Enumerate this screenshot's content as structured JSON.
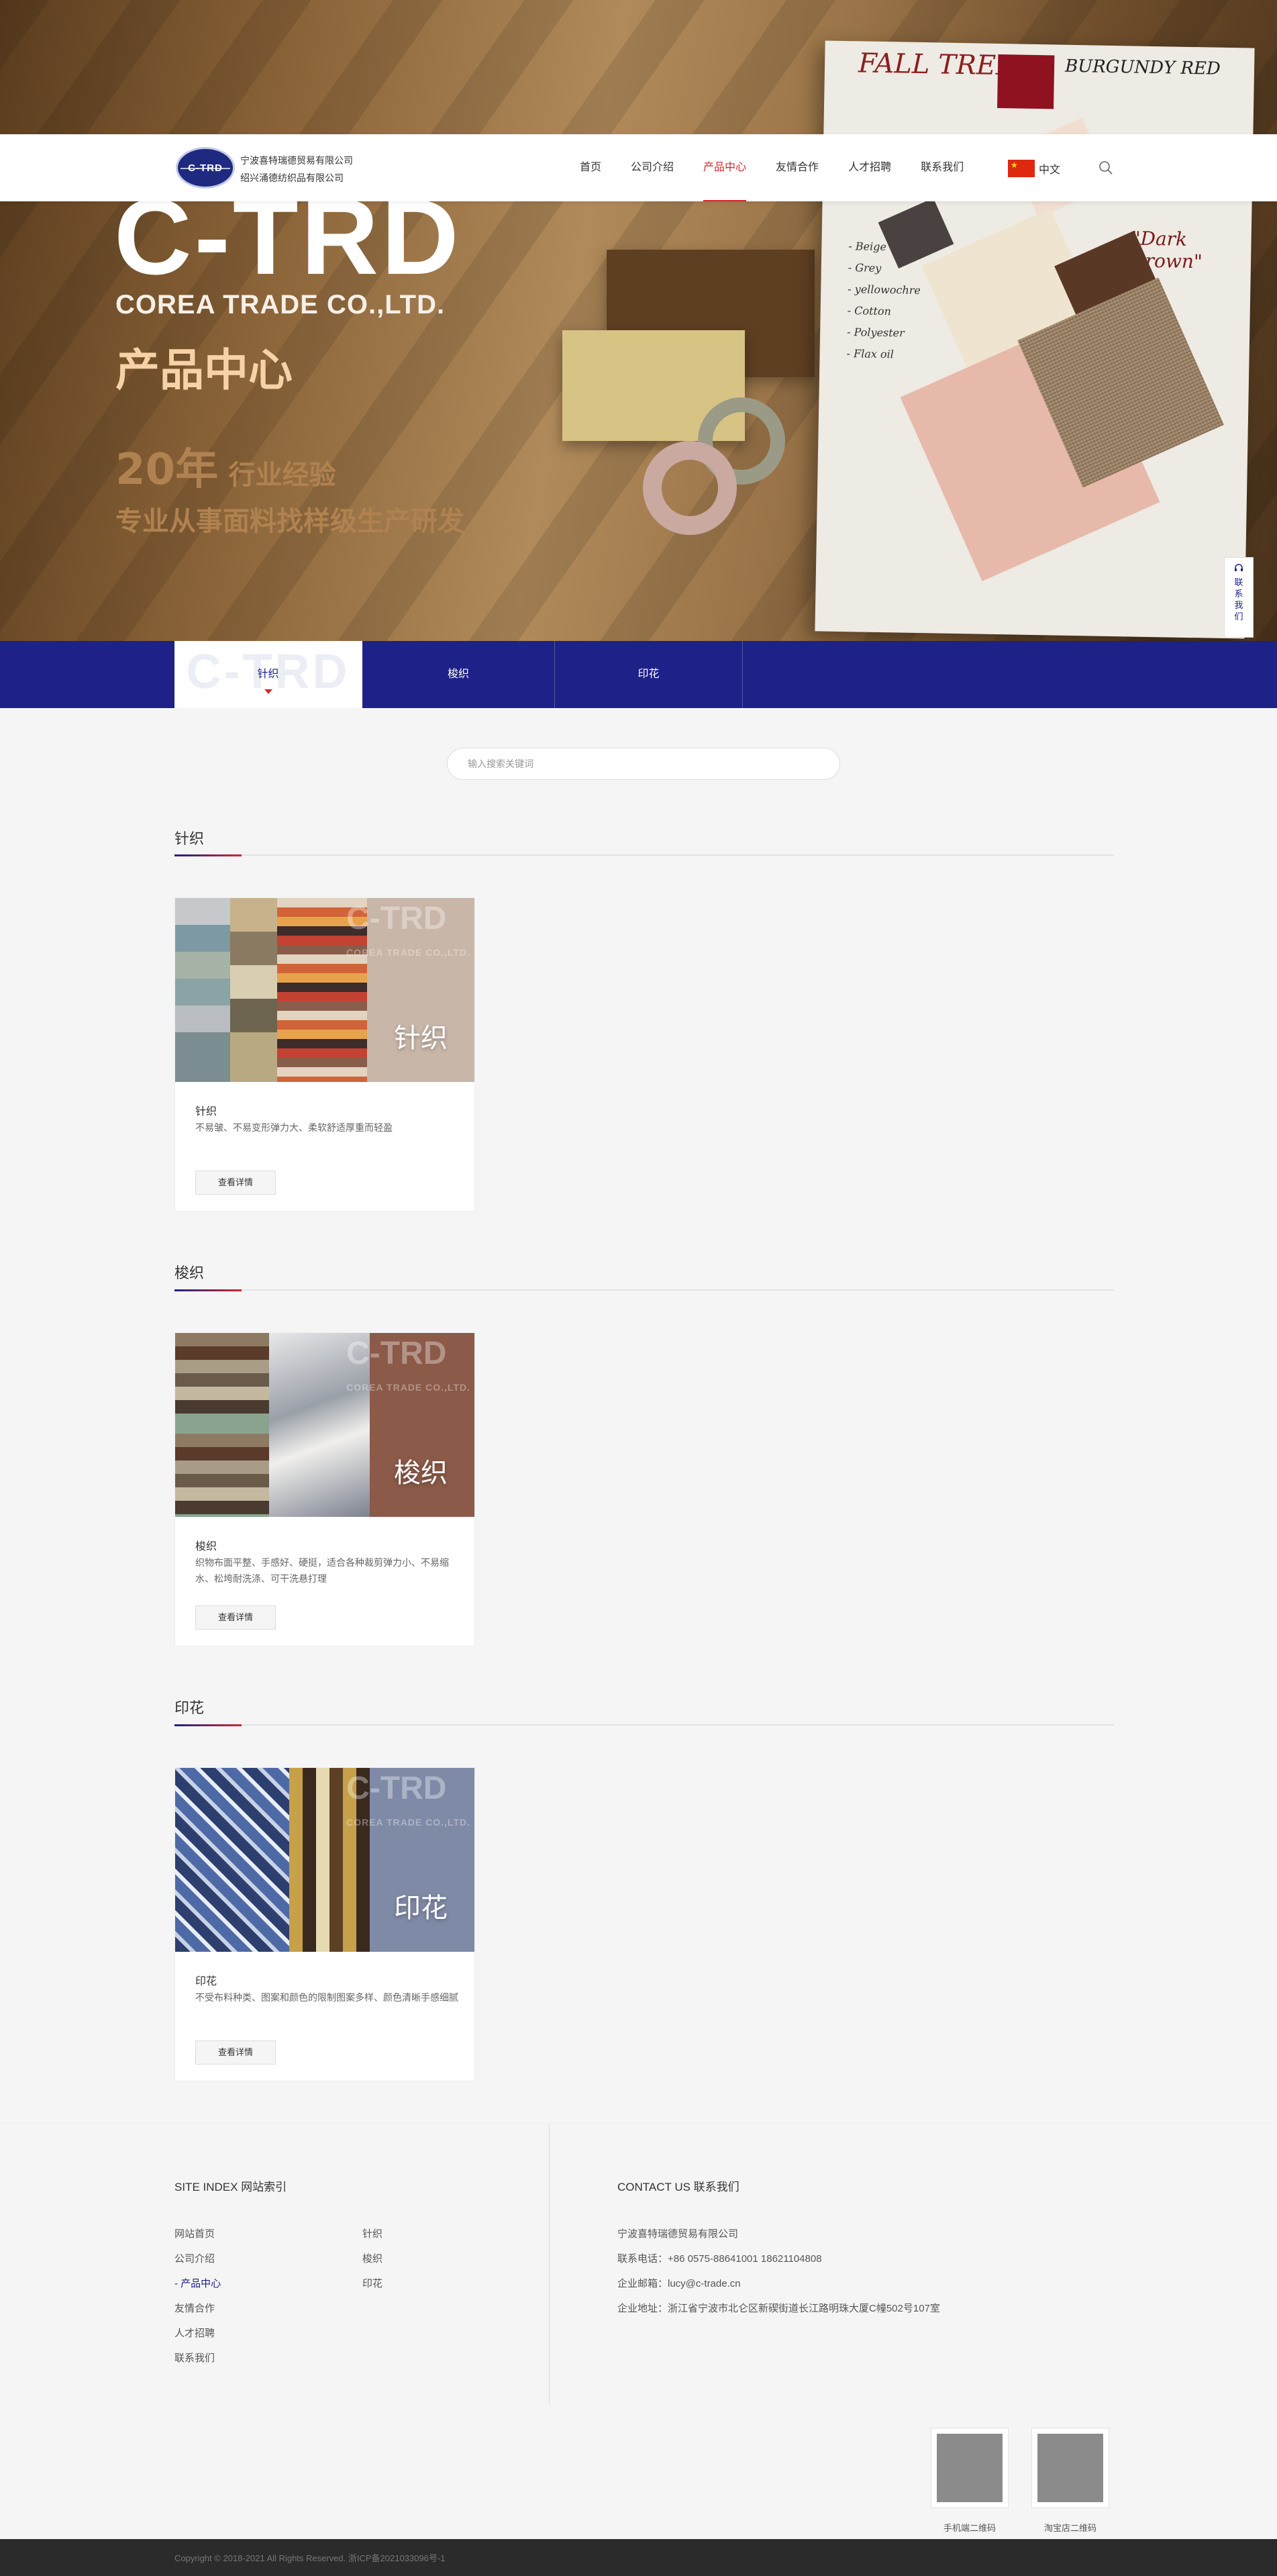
{
  "banner": {
    "brand": "C-TRD",
    "brand_sub": "COREA TRADE CO.,LTD.",
    "page_title": "产品中心",
    "years_num": "20年",
    "years_text": "行业经验",
    "slogan": "专业从事面料找样级生产研发",
    "board_title": "FALL TREND",
    "board_red": "BURGUNDY RED",
    "board_brown": "\"Dark Brown\"",
    "board_notes": [
      "- Beige",
      "- Grey",
      "- yellowochre",
      "- Cotton",
      "- Polyester",
      "- Flax oil"
    ]
  },
  "header": {
    "logo_text": "C-TRD",
    "company_line1": "宁波喜特瑞德贸易有限公司",
    "company_line2": "绍兴涌德纺织品有限公司",
    "nav": [
      "首页",
      "公司介绍",
      "产品中心",
      "友情合作",
      "人才招聘",
      "联系我们"
    ],
    "lang": "中文"
  },
  "side": {
    "contact": [
      "联",
      "系",
      "我",
      "们"
    ]
  },
  "categories": {
    "watermark": "C-TRD",
    "tabs": [
      "针织",
      "梭织",
      "印花"
    ]
  },
  "search": {
    "placeholder": "输入搜索关键词"
  },
  "sections": [
    {
      "title": "针织",
      "product": {
        "name": "针织",
        "desc": "不易皱、不易变形弹力大、柔软舒适厚重而轻盈",
        "img_label": "针织",
        "button": "查看详情"
      }
    },
    {
      "title": "梭织",
      "product": {
        "name": "梭织",
        "desc": "织物布面平整、手感好、硬挺，适合各种裁剪弹力小、不易缩水、松垮耐洗涤、可干洗悬打理",
        "img_label": "梭织",
        "button": "查看详情"
      }
    },
    {
      "title": "印花",
      "product": {
        "name": "印花",
        "desc": "不受布料种类、图案和颜色的限制图案多样、颜色清晰手感细腻",
        "img_label": "印花",
        "button": "查看详情"
      }
    }
  ],
  "card_watermark": {
    "main": "C-TRD",
    "sub": "COREA TRADE CO.,LTD."
  },
  "footer": {
    "site_index_title": "SITE INDEX 网站索引",
    "contact_title": "CONTACT US 联系我们",
    "links_col1": [
      "网站首页",
      "公司介绍",
      "- 产品中心",
      "友情合作",
      "人才招聘",
      "联系我们"
    ],
    "links_col2": [
      "针织",
      "梭织",
      "印花"
    ],
    "contact_info": [
      "宁波喜特瑞德贸易有限公司",
      "联系电话：+86 0575-88641001 18621104808",
      "企业邮箱：lucy@c-trade.cn",
      "企业地址：浙江省宁波市北仑区新碶街道长江路明珠大厦C幢502号107室"
    ],
    "qr_labels": [
      "手机端二维码",
      "淘宝店二维码"
    ],
    "copyright": "Copyright © 2018-2021 All Rights Reserved. 浙ICP备2021033096号-1"
  },
  "colors": {
    "primary": "#1d2188",
    "accent": "#d2282d"
  }
}
